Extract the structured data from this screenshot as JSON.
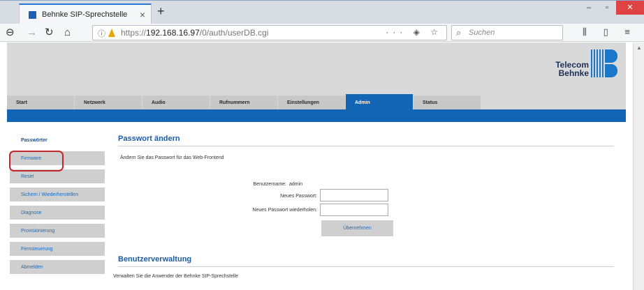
{
  "browser": {
    "tab_title": "Behnke SIP-Sprechstelle",
    "tab_close": "×",
    "new_tab": "+",
    "win_min": "–",
    "win_max": "▫",
    "win_close": "✕",
    "url_scheme": "https://",
    "url_host": "192.168.16.97",
    "url_path": "/0/auth/userDB.cgi",
    "url_actions": "··· ◈ ☆",
    "search_placeholder": "Suchen",
    "right_icons": "⫼ ▯ ≡",
    "icons": {
      "back": "back-arrow-icon",
      "forward": "forward-arrow-icon",
      "reload": "reload-icon",
      "home": "home-icon",
      "info": "info-icon",
      "lock": "lock-warning-icon",
      "search": "search-icon"
    },
    "accent_color": "#2b79d6"
  },
  "brand": {
    "line1": "Telecom",
    "line2": "Behnke",
    "color": "#1b78c8"
  },
  "nav": {
    "tabs": [
      {
        "label": "Start",
        "active": false
      },
      {
        "label": "Netzwerk",
        "active": false
      },
      {
        "label": "Audio",
        "active": false
      },
      {
        "label": "Rufnummern",
        "active": false
      },
      {
        "label": "Einstellungen",
        "active": false
      },
      {
        "label": "Admin",
        "active": true
      },
      {
        "label": "Status",
        "active": false
      }
    ],
    "active_color": "#1264b4"
  },
  "sidebar": {
    "items": [
      {
        "label": "Passwörter",
        "current": true
      },
      {
        "label": "Firmware",
        "current": false,
        "highlighted": true
      },
      {
        "label": "Reset",
        "current": false
      },
      {
        "label": "Sichern / Wiederherstellen",
        "current": false
      },
      {
        "label": "Diagnose",
        "current": false
      },
      {
        "label": "Provisionierung",
        "current": false
      },
      {
        "label": "Fernsteuerung",
        "current": false
      },
      {
        "label": "Abmelden",
        "current": false
      }
    ],
    "highlight_color": "#c0262d"
  },
  "password_section": {
    "title": "Passwort ändern",
    "description": "Ändern Sie das Passwort für das Web-Frontend",
    "username_label": "Benutzername:",
    "username_value": "admin",
    "new_password_label": "Neues Passwort:",
    "repeat_password_label": "Neues Passwort wiederholen:",
    "submit_label": "Übernehmen"
  },
  "user_section": {
    "title": "Benutzerverwaltung",
    "description": "Verwalten Sie die Anwender der Behnke SIP-Sprechstelle"
  }
}
